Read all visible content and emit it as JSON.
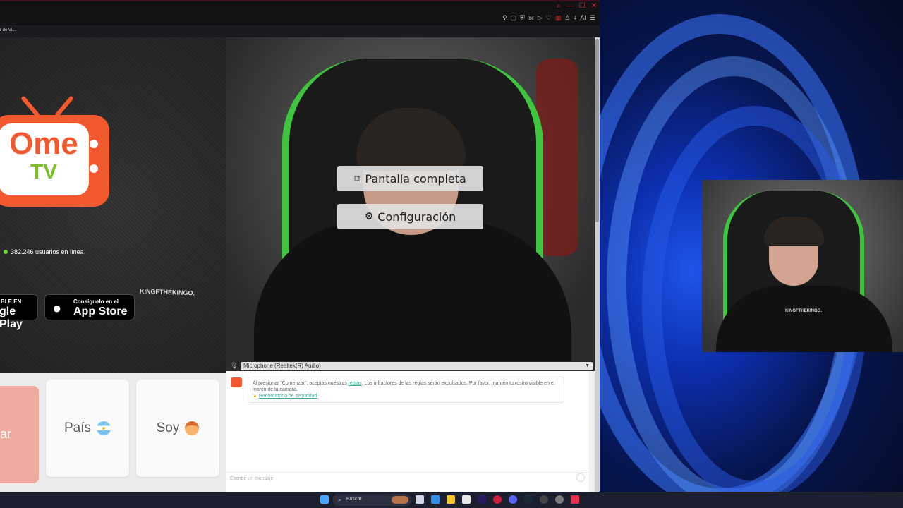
{
  "browser": {
    "tab_label": "r de Vi...",
    "window_controls": [
      "search-icon",
      "minimize-icon",
      "maximize-icon",
      "close-icon"
    ],
    "toolbar_icons": [
      "pin-icon",
      "tab-icon",
      "shield-icon",
      "translate-icon",
      "play-icon",
      "heart-icon",
      "split-icon",
      "profile-icon",
      "download-icon",
      "ai-icon",
      "menu-icon"
    ],
    "toolbar_ai_label": "AI"
  },
  "left_panel": {
    "logo_ome": "Ome",
    "logo_tv": "TV",
    "online_count": "382.246 usuarios en línea",
    "google_small": "BLE EN",
    "google_big": "gle Play",
    "apple_small": "Consíguelo en el",
    "apple_big": "App Store"
  },
  "video": {
    "fullscreen_label": "Pantalla completa",
    "settings_label": "Configuración",
    "shirt_text": "KINGFTHEKINGO."
  },
  "mic": {
    "selected": "Microphone (Realtek(R) Audio)"
  },
  "controls": {
    "start_label": "ar",
    "country_label": "País",
    "gender_label": "Soy"
  },
  "chat": {
    "rules_prefix": "Al presionar \"Comenzar\", aceptas nuestras ",
    "rules_link": "reglas",
    "rules_suffix": ". Los infractores de las reglas serán expulsados. Por favor, mantén tu rostro visible en el marco de la cámara.",
    "safety_link": "Recordatorio de seguridad",
    "message_placeholder": "Escribe un mensaje"
  },
  "webcam": {
    "shirt_text": "KINGFTHEKINGO."
  },
  "taskbar": {
    "search_label": "Buscar",
    "pinned": [
      "windows-icon",
      "widgets-icon",
      "task-view-icon",
      "edge-icon",
      "explorer-icon",
      "store-icon",
      "premiere-icon",
      "opera-icon",
      "discord-icon",
      "steam-icon",
      "vpn-icon",
      "chrome-icon",
      "tiktok-icon"
    ]
  }
}
